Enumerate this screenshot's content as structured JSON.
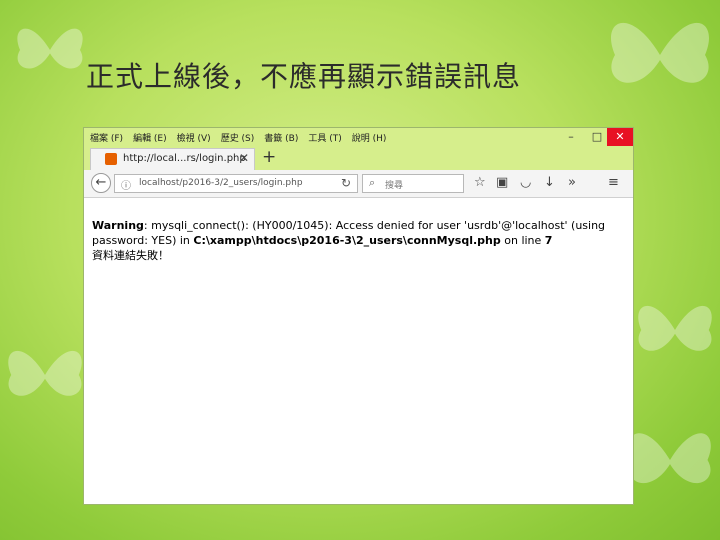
{
  "slide": {
    "title": "正式上線後，不應再顯示錯誤訊息"
  },
  "browser": {
    "menu": [
      "檔案 (F)",
      "編輯 (E)",
      "檢視 (V)",
      "歷史 (S)",
      "書籤 (B)",
      "工具 (T)",
      "說明 (H)"
    ],
    "window_controls": {
      "minimize": "–",
      "maximize": "□",
      "close": "✕"
    },
    "tab": {
      "title": "http://local...rs/login.php",
      "close": "✕"
    },
    "new_tab": "+",
    "url": "localhost/p2016-3/2_users/login.php",
    "search_placeholder": "搜尋"
  },
  "page": {
    "warning_label": "Warning",
    "warning_text_1": ": mysqli_connect(): (HY000/1045): Access denied for user 'usrdb'@'localhost' (using password: YES) in ",
    "warning_path": "C:\\xampp\\htdocs\\p2016-3\\2_users\\connMysql.php",
    "warning_text_2": " on line ",
    "warning_line": "7",
    "failure_message": "資料連結失敗！"
  },
  "colors": {
    "background": "#b8e05e",
    "browser_chrome": "#d6ee8c",
    "close_button": "#e81123"
  }
}
